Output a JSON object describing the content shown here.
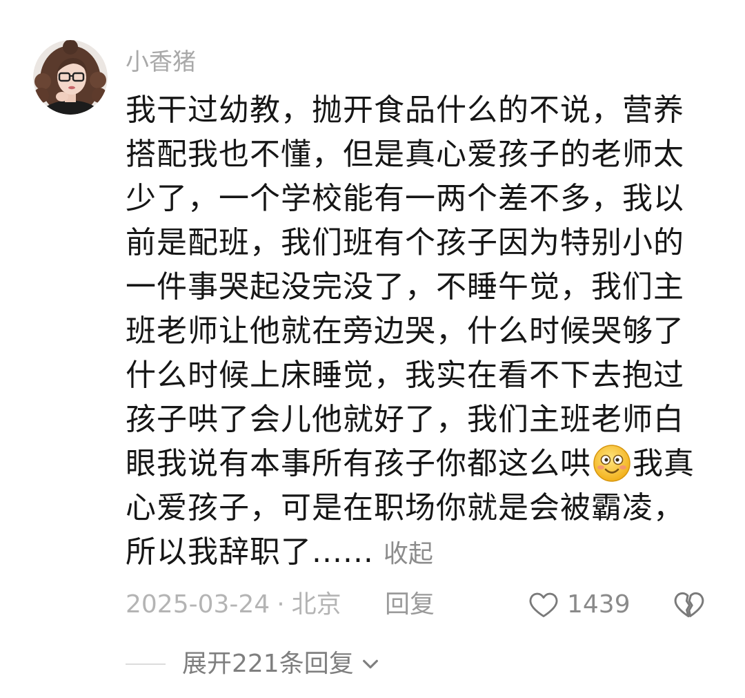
{
  "user": {
    "name": "小香猪",
    "avatar_icon": "avatar-photo"
  },
  "comment": {
    "lines": [
      "我干过幼教，抛开食品什么的不说，营养",
      "搭配我也不懂，但是真心爱孩子的老师太",
      "少了，一个学校能有一两个差不多，我以",
      "前是配班，我们班有个孩子因为特别小的",
      "一件事哭起没完没了，不睡午觉，我们主",
      "班老师让他就在旁边哭，什么时候哭够了",
      "什么时候上床睡觉，我实在看不下去抱过",
      "孩子哄了会儿他就好了，我们主班老师白",
      {
        "before": "眼我说有本事所有孩子你都这么哄",
        "emoji": "smile-emoji",
        "after": "我真"
      },
      "心爱孩子，可是在职场你就是会被霸凌，",
      "所以我辞职了......"
    ],
    "collapse_label": "收起"
  },
  "meta": {
    "date": "2025-03-24",
    "separator": "·",
    "location": "北京",
    "reply_label": "回复",
    "like_icon": "heart-outline-icon",
    "like_count": "1439",
    "dislike_icon": "broken-heart-icon"
  },
  "replies": {
    "expand_label": "展开221条回复",
    "chevron_icon": "chevron-down-icon"
  },
  "colors": {
    "background": "#ffffff",
    "text": "#161616",
    "muted": "#b4b4b4",
    "secondary": "#8a8a8a",
    "icon": "#7a7a7a",
    "emoji_yellow": "#f7c12c"
  }
}
